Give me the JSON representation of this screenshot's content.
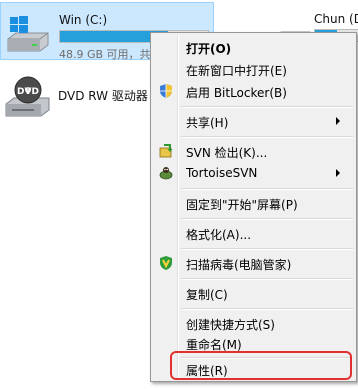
{
  "drives": {
    "c": {
      "name": "Win (C:)",
      "free_text": "48.9 GB 可用，共",
      "used_fraction": 0.73,
      "icon": "windows-drive-icon"
    },
    "d": {
      "name": "Chun (D:",
      "used_fraction": 0.5,
      "icon": "hard-drive-icon"
    },
    "dvd": {
      "name": "DVD RW 驱动器",
      "icon": "dvd-drive-icon"
    }
  },
  "context_menu": {
    "open": "打开(O)",
    "open_new_window": "在新窗口中打开(E)",
    "bitlocker": "启用 BitLocker(B)",
    "share": "共享(H)",
    "svn_checkout": "SVN 检出(K)...",
    "tortoise_svn": "TortoiseSVN",
    "pin_start": "固定到\"开始\"屏幕(P)",
    "format": "格式化(A)...",
    "scan_virus": "扫描病毒(电脑管家)",
    "copy": "复制(C)",
    "create_shortcut": "创建快捷方式(S)",
    "rename": "重命名(M)",
    "properties": "属性(R)"
  },
  "colors": {
    "selection_bg": "#cce8ff",
    "capacity_fill": "#26a0da",
    "highlight_border": "#e0312f",
    "menu_bg": "#f0f0f0"
  }
}
